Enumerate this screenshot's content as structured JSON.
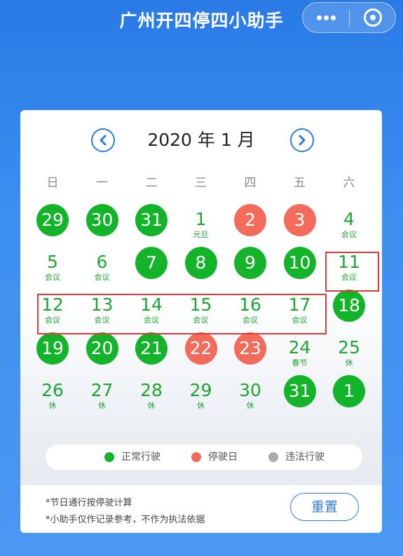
{
  "app": {
    "title": "广州开四停四小助手"
  },
  "calendar": {
    "month_title": "2020 年 1 月",
    "weekdays": [
      "日",
      "一",
      "二",
      "三",
      "四",
      "五",
      "六"
    ],
    "days": [
      {
        "n": "29",
        "type": "green",
        "sub": ""
      },
      {
        "n": "30",
        "type": "green",
        "sub": ""
      },
      {
        "n": "31",
        "type": "green",
        "sub": ""
      },
      {
        "n": "1",
        "type": "plain",
        "sub": "元旦"
      },
      {
        "n": "2",
        "type": "red",
        "sub": ""
      },
      {
        "n": "3",
        "type": "red",
        "sub": ""
      },
      {
        "n": "4",
        "type": "plain",
        "sub": "会议"
      },
      {
        "n": "5",
        "type": "plain",
        "sub": "会议"
      },
      {
        "n": "6",
        "type": "plain",
        "sub": "会议"
      },
      {
        "n": "7",
        "type": "green",
        "sub": ""
      },
      {
        "n": "8",
        "type": "green",
        "sub": ""
      },
      {
        "n": "9",
        "type": "green",
        "sub": ""
      },
      {
        "n": "10",
        "type": "green",
        "sub": ""
      },
      {
        "n": "11",
        "type": "plain",
        "sub": "会议"
      },
      {
        "n": "12",
        "type": "plain",
        "sub": "会议"
      },
      {
        "n": "13",
        "type": "plain",
        "sub": "会议"
      },
      {
        "n": "14",
        "type": "plain",
        "sub": "会议"
      },
      {
        "n": "15",
        "type": "plain",
        "sub": "会议"
      },
      {
        "n": "16",
        "type": "plain",
        "sub": "会议"
      },
      {
        "n": "17",
        "type": "plain",
        "sub": "会议"
      },
      {
        "n": "18",
        "type": "green",
        "sub": ""
      },
      {
        "n": "19",
        "type": "green",
        "sub": ""
      },
      {
        "n": "20",
        "type": "green",
        "sub": ""
      },
      {
        "n": "21",
        "type": "green",
        "sub": ""
      },
      {
        "n": "22",
        "type": "red",
        "sub": ""
      },
      {
        "n": "23",
        "type": "red",
        "sub": ""
      },
      {
        "n": "24",
        "type": "plain",
        "sub": "春节"
      },
      {
        "n": "25",
        "type": "plain",
        "sub": "休"
      },
      {
        "n": "26",
        "type": "plain",
        "sub": "休"
      },
      {
        "n": "27",
        "type": "plain",
        "sub": "休"
      },
      {
        "n": "28",
        "type": "plain",
        "sub": "休"
      },
      {
        "n": "29",
        "type": "plain",
        "sub": "休"
      },
      {
        "n": "30",
        "type": "plain",
        "sub": "休"
      },
      {
        "n": "31",
        "type": "green",
        "sub": ""
      },
      {
        "n": "1",
        "type": "green",
        "sub": ""
      }
    ]
  },
  "legend": [
    {
      "label": "正常行驶",
      "color": "#14b42a"
    },
    {
      "label": "停驶日",
      "color": "#f26b5b"
    },
    {
      "label": "违法行驶",
      "color": "#aaaaaa"
    }
  ],
  "footer": {
    "note1": "*节日通行按停驶计算",
    "note2": "*小助手仅作记录参考，不作为执法依据",
    "reset_label": "重置"
  },
  "icons": [
    "more-icon",
    "close-target-icon",
    "chevron-left-icon",
    "chevron-right-icon"
  ],
  "colors": {
    "accent": "#2e7be0",
    "green": "#14b42a",
    "red": "#f26b5b",
    "highlight": "#e03a3a"
  }
}
